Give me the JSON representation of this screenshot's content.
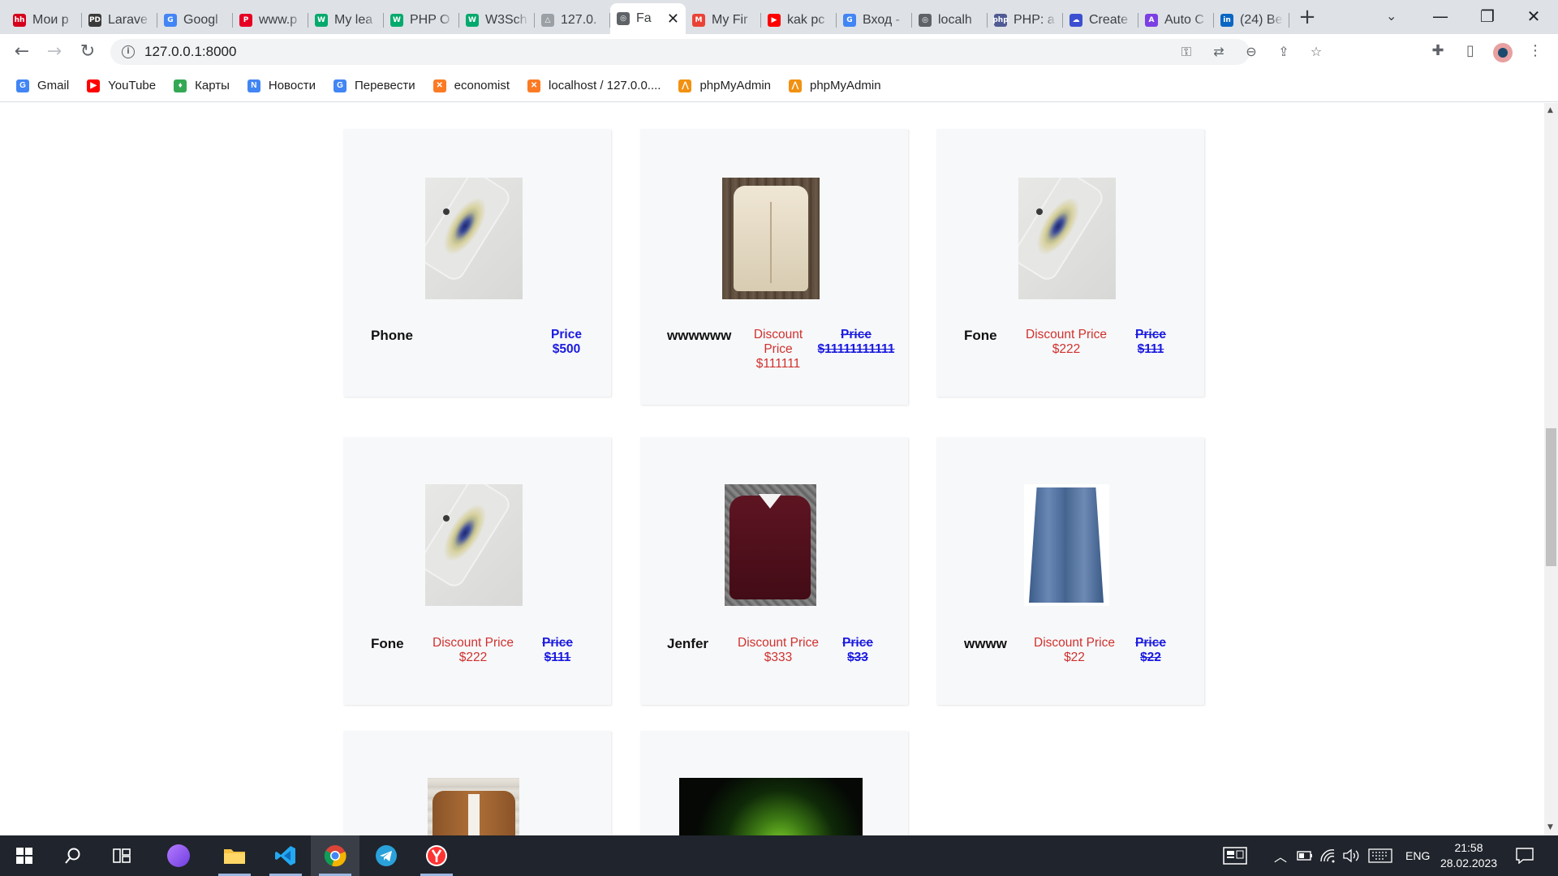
{
  "browser": {
    "tabs": [
      {
        "title": "Мои р",
        "favicon": "hh-icon",
        "color": "#d6001c",
        "glyph": "hh"
      },
      {
        "title": "Larave",
        "favicon": "pd-icon",
        "color": "#3a3a3a",
        "glyph": "PD"
      },
      {
        "title": "Googl",
        "favicon": "google-translate-icon",
        "color": "#4285f4",
        "glyph": "G"
      },
      {
        "title": "www.p",
        "favicon": "pinterest-icon",
        "color": "#e60023",
        "glyph": "P"
      },
      {
        "title": "My lea",
        "favicon": "w3-icon",
        "color": "#04aa6d",
        "glyph": "W"
      },
      {
        "title": "PHP O",
        "favicon": "w3-icon",
        "color": "#04aa6d",
        "glyph": "W"
      },
      {
        "title": "W3Sch",
        "favicon": "w3-icon",
        "color": "#04aa6d",
        "glyph": "W"
      },
      {
        "title": "127.0.",
        "favicon": "phpmyadmin-icon",
        "color": "#9aa0a6",
        "glyph": "△"
      },
      {
        "title": "Fa",
        "favicon": "globe-icon",
        "color": "#5f6368",
        "glyph": "◎",
        "active": true
      },
      {
        "title": "My Fir",
        "favicon": "gmail-icon",
        "color": "#ea4335",
        "glyph": "M"
      },
      {
        "title": "kak pc",
        "favicon": "youtube-icon",
        "color": "#ff0000",
        "glyph": "▶"
      },
      {
        "title": "Вход -",
        "favicon": "google-icon",
        "color": "#4285f4",
        "glyph": "G"
      },
      {
        "title": "localh",
        "favicon": "globe-icon",
        "color": "#5f6368",
        "glyph": "◎"
      },
      {
        "title": "PHP: a",
        "favicon": "php-icon",
        "color": "#4f5b93",
        "glyph": "php"
      },
      {
        "title": "Create",
        "favicon": "cloud-icon",
        "color": "#3b4fd0",
        "glyph": "☁"
      },
      {
        "title": "Auto C",
        "favicon": "a-icon",
        "color": "#7b3fe4",
        "glyph": "A"
      },
      {
        "title": "(24) Be",
        "favicon": "linkedin-icon",
        "color": "#0a66c2",
        "glyph": "in"
      }
    ],
    "new_tab_glyph": "+",
    "tab_search_glyph": "⌄",
    "window_controls": {
      "minimize": "—",
      "restore": "❐",
      "close": "✕"
    },
    "url": "127.0.0.1:8000",
    "nav": {
      "back": "←",
      "forward": "→",
      "reload": "↻"
    },
    "bookmarks": [
      {
        "label": "Gmail",
        "favicon": "google-icon",
        "color": "#4285f4",
        "glyph": "G"
      },
      {
        "label": "YouTube",
        "favicon": "youtube-icon",
        "color": "#ff0000",
        "glyph": "▶"
      },
      {
        "label": "Карты",
        "favicon": "maps-icon",
        "color": "#34a853",
        "glyph": "♦"
      },
      {
        "label": "Новости",
        "favicon": "news-icon",
        "color": "#4285f4",
        "glyph": "N"
      },
      {
        "label": "Перевести",
        "favicon": "google-translate-icon",
        "color": "#4285f4",
        "glyph": "G"
      },
      {
        "label": "economist",
        "favicon": "xampp-icon",
        "color": "#fb7a24",
        "glyph": "✕"
      },
      {
        "label": "localhost / 127.0.0....",
        "favicon": "xampp-icon",
        "color": "#fb7a24",
        "glyph": "✕"
      },
      {
        "label": "phpMyAdmin",
        "favicon": "phpmyadmin-icon",
        "color": "#f29111",
        "glyph": "⋀"
      },
      {
        "label": "phpMyAdmin",
        "favicon": "phpmyadmin-icon",
        "color": "#f29111",
        "glyph": "⋀"
      }
    ]
  },
  "products": [
    {
      "name": "Phone",
      "image": "phone",
      "price_label": "Price",
      "price": "$500"
    },
    {
      "name": "wwwwww",
      "image": "shirt",
      "discount_label": "Discount Price",
      "discount_price": "$111111",
      "price_label": "Price",
      "price": "$11111111111"
    },
    {
      "name": "Fone",
      "image": "phone",
      "discount_label": "Discount Price",
      "discount_price": "$222",
      "price_label": "Price",
      "price": "$111"
    },
    {
      "name": "Fone",
      "image": "phone",
      "discount_label": "Discount Price",
      "discount_price": "$222",
      "price_label": "Price",
      "price": "$111"
    },
    {
      "name": "Jenfer",
      "image": "sweater",
      "discount_label": "Discount Price",
      "discount_price": "$333",
      "price_label": "Price",
      "price": "$33"
    },
    {
      "name": "wwww",
      "image": "jeans",
      "discount_label": "Discount Price",
      "discount_price": "$22",
      "price_label": "Price",
      "price": "$22"
    },
    {
      "image": "jacket"
    },
    {
      "image": "glow"
    }
  ],
  "taskbar": {
    "apps": [
      {
        "name": "start",
        "glyph": "⊞"
      },
      {
        "name": "search",
        "glyph": "⚲"
      },
      {
        "name": "task-view",
        "glyph": "⧉"
      },
      {
        "name": "alice",
        "glyph": "●"
      },
      {
        "name": "file-explorer",
        "glyph": "▬"
      },
      {
        "name": "vscode",
        "glyph": "⟨⟩"
      },
      {
        "name": "chrome",
        "glyph": "◉"
      },
      {
        "name": "telegram",
        "glyph": "➤"
      },
      {
        "name": "yandex-browser",
        "glyph": "Y"
      }
    ],
    "language": "ENG",
    "time": "21:58",
    "date": "28.02.2023"
  }
}
